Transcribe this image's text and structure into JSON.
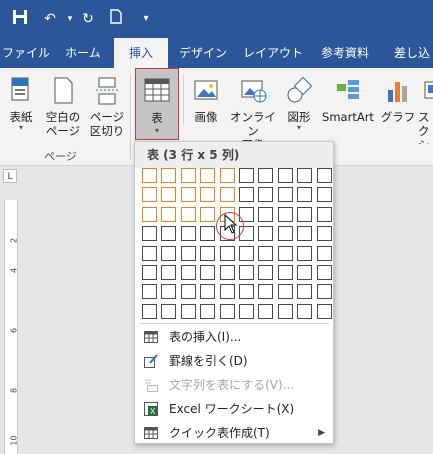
{
  "quick_access": {
    "icons": [
      "save-icon",
      "undo-icon",
      "redo-icon",
      "new-document-icon",
      "customize-icon"
    ]
  },
  "tabs": [
    {
      "label": "ファイル"
    },
    {
      "label": "ホーム"
    },
    {
      "label": "挿入",
      "active": true
    },
    {
      "label": "デザイン"
    },
    {
      "label": "レイアウト"
    },
    {
      "label": "参考資料"
    },
    {
      "label": "差し込"
    }
  ],
  "ribbon": {
    "cover_page": {
      "label": "表紙"
    },
    "blank_page": {
      "label": "空白の\nページ"
    },
    "page_break": {
      "label": "ページ\n区切り"
    },
    "pages_group_label": "ページ",
    "table": {
      "label": "表"
    },
    "pictures": {
      "label": "画像"
    },
    "online_pictures": {
      "label": "オンライン\n画像"
    },
    "shapes": {
      "label": "図形"
    },
    "smartart": {
      "label": "SmartArt"
    },
    "chart": {
      "label": "グラフ"
    },
    "screenshot": {
      "label": "スク\nショ"
    }
  },
  "dropdown": {
    "header": "表 (3 行 x 5 列)",
    "grid_cols": 10,
    "grid_rows": 8,
    "highlight_rows": 3,
    "highlight_cols": 5,
    "menu": [
      {
        "label": "表の挿入(I)...",
        "icon": "insert-table-icon",
        "disabled": false
      },
      {
        "label": "罫線を引く(D)",
        "icon": "draw-table-icon",
        "disabled": false
      },
      {
        "label": "文字列を表にする(V)...",
        "icon": "convert-text-to-table-icon",
        "disabled": true
      },
      {
        "label": "Excel ワークシート(X)",
        "icon": "excel-spreadsheet-icon",
        "disabled": false
      },
      {
        "label": "クイック表作成(T)",
        "icon": "quick-tables-icon",
        "disabled": false,
        "submenu": true
      }
    ]
  },
  "ruler": {
    "tab_selector": "L",
    "numbers": [
      "2",
      "4",
      "6",
      "8",
      "10"
    ]
  },
  "colors": {
    "ribbon_blue": "#2b579a",
    "highlight_orange": "#e8822a",
    "selection_red": "#c43b3b"
  }
}
